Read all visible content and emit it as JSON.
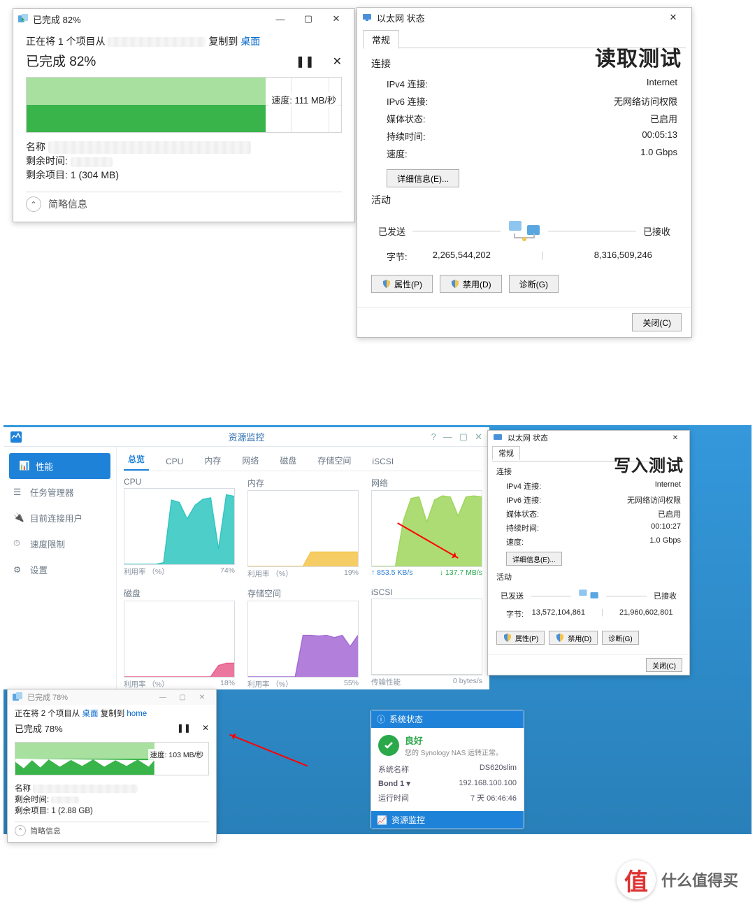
{
  "copy1": {
    "title": "已完成 82%",
    "sub_pre": "正在将 1 个项目从",
    "sub_mid": "复制到",
    "sub_dest": "桌面",
    "done_line": "已完成 82%",
    "pause_icon": "pause-icon",
    "cancel_icon": "close-icon",
    "speed_label": "速度:",
    "speed_value": "111 MB/秒",
    "name_label": "名称",
    "remaining_time_label": "剩余时间:",
    "remaining_items_label": "剩余项目:",
    "remaining_items_value": "1 (304 MB)",
    "brief_label": "简略信息",
    "pct_fill": 75
  },
  "eth1": {
    "title": "以太网 状态",
    "tab": "常规",
    "overlay_title": "读取测试",
    "conn_title": "连接",
    "ipv4_k": "IPv4 连接:",
    "ipv4_v": "Internet",
    "ipv6_k": "IPv6 连接:",
    "ipv6_v": "无网络访问权限",
    "media_k": "媒体状态:",
    "media_v": "已启用",
    "duration_k": "持续时间:",
    "duration_v": "00:05:13",
    "speed_k": "速度:",
    "speed_v": "1.0 Gbps",
    "details_btn": "详细信息(E)...",
    "activity_title": "活动",
    "sent_label": "已发送",
    "recv_label": "已接收",
    "bytes_k": "字节:",
    "sent_bytes": "2,265,544,202",
    "recv_bytes": "8,316,509,246",
    "props_btn": "属性(P)",
    "disable_btn": "禁用(D)",
    "diag_btn": "诊断(G)",
    "close_btn": "关闭(C)"
  },
  "rm": {
    "title": "资源监控",
    "sidebar": {
      "items": [
        {
          "label": "性能",
          "icon": "chart-icon"
        },
        {
          "label": "任务管理器",
          "icon": "list-icon"
        },
        {
          "label": "目前连接用户",
          "icon": "plug-icon"
        },
        {
          "label": "速度限制",
          "icon": "gauge-icon"
        },
        {
          "label": "设置",
          "icon": "gear-icon"
        }
      ]
    },
    "tabs": [
      "总览",
      "CPU",
      "内存",
      "网络",
      "磁盘",
      "存储空间",
      "iSCSI"
    ],
    "panes": {
      "cpu": {
        "title": "CPU",
        "footer_l": "利用率 （%）",
        "footer_r": "74%"
      },
      "mem": {
        "title": "内存",
        "footer_l": "利用率 （%）",
        "footer_r": "19%"
      },
      "net": {
        "title": "网络",
        "up": "↑ 853.5 KB/s",
        "down": "↓ 137.7 MB/s"
      },
      "disk": {
        "title": "磁盘",
        "footer_l": "利用率 （%）",
        "footer_r": "18%"
      },
      "vol": {
        "title": "存储空间",
        "footer_l": "利用率 （%）",
        "footer_r": "55%"
      },
      "iscsi": {
        "title": "iSCSI",
        "footer_l": "传输性能",
        "footer_r": "0 bytes/s"
      }
    }
  },
  "eth2": {
    "title": "以太网 状态",
    "tab": "常规",
    "overlay_title": "写入测试",
    "conn_title": "连接",
    "ipv4_k": "IPv4 连接:",
    "ipv4_v": "Internet",
    "ipv6_k": "IPv6 连接:",
    "ipv6_v": "无网络访问权限",
    "media_k": "媒体状态:",
    "media_v": "已启用",
    "duration_k": "持续时间:",
    "duration_v": "00:10:27",
    "speed_k": "速度:",
    "speed_v": "1.0 Gbps",
    "details_btn": "详细信息(E)...",
    "activity_title": "活动",
    "sent_label": "已发送",
    "recv_label": "已接收",
    "bytes_k": "字节:",
    "sent_bytes": "13,572,104,861",
    "recv_bytes": "21,960,602,801",
    "props_btn": "属性(P)",
    "disable_btn": "禁用(D)",
    "diag_btn": "诊断(G)",
    "close_btn": "关闭(C)"
  },
  "copy2": {
    "title": "已完成 78%",
    "sub_pre": "正在将 2 个项目从",
    "sub_src": "桌面",
    "sub_mid": "复制到",
    "sub_dest": "home",
    "done_line": "已完成 78%",
    "speed_label": "速度:",
    "speed_value": "103 MB/秒",
    "name_label": "名称",
    "remaining_time_label": "剩余时间:",
    "remaining_items_label": "剩余项目:",
    "remaining_items_value": "1 (2.88 GB)",
    "brief_label": "简略信息",
    "pct_fill": 72
  },
  "sys": {
    "header": "系统状态",
    "good": "良好",
    "good_sub": "您的 Synology NAS 运转正常。",
    "name_k": "系统名称",
    "name_v": "DS620slim",
    "bond_k": "Bond 1 ▾",
    "bond_v": "192.168.100.100",
    "uptime_k": "运行时间",
    "uptime_v": "7 天 06:46:46",
    "rm_label": "资源监控"
  },
  "badge": {
    "glyph": "值",
    "text": "什么值得买"
  },
  "chart_data": [
    {
      "type": "area",
      "title": "CPU",
      "ylabel": "利用率 %",
      "ylim": [
        0,
        100
      ],
      "series": [
        {
          "name": "cpu",
          "values": [
            0,
            0,
            0,
            0,
            0,
            2,
            85,
            82,
            60,
            78,
            86,
            88,
            20,
            92,
            90
          ]
        }
      ],
      "color": "#2fc6c0"
    },
    {
      "type": "area",
      "title": "内存",
      "ylabel": "利用率 %",
      "ylim": [
        0,
        100
      ],
      "series": [
        {
          "name": "mem",
          "values": [
            0,
            0,
            0,
            0,
            0,
            0,
            0,
            0,
            19,
            19,
            19,
            19,
            19,
            19,
            19
          ]
        }
      ],
      "color": "#f4c44a"
    },
    {
      "type": "area",
      "title": "网络",
      "ylabel": "MB/s",
      "ylim": [
        0,
        150
      ],
      "series": [
        {
          "name": "下载",
          "values": [
            0,
            0,
            0,
            0,
            90,
            135,
            138,
            88,
            132,
            140,
            138,
            100,
            138,
            140,
            138
          ]
        }
      ],
      "color": "#9ed65b",
      "annotations": {
        "upload": "853.5 KB/s",
        "download": "137.7 MB/s"
      }
    },
    {
      "type": "area",
      "title": "磁盘",
      "ylabel": "利用率 %",
      "ylim": [
        0,
        100
      ],
      "series": [
        {
          "name": "disk",
          "values": [
            0,
            0,
            0,
            0,
            0,
            0,
            0,
            0,
            0,
            0,
            0,
            0,
            15,
            18,
            18
          ]
        }
      ],
      "color": "#e85f8e"
    },
    {
      "type": "area",
      "title": "存储空间",
      "ylabel": "利用率 %",
      "ylim": [
        0,
        100
      ],
      "series": [
        {
          "name": "vol",
          "values": [
            0,
            0,
            0,
            0,
            0,
            0,
            0,
            55,
            55,
            54,
            55,
            52,
            55,
            40,
            55
          ]
        }
      ],
      "color": "#a46ad4"
    },
    {
      "type": "area",
      "title": "iSCSI",
      "ylabel": "bytes/s",
      "ylim": [
        0,
        1
      ],
      "series": [
        {
          "name": "iscsi",
          "values": [
            0,
            0,
            0,
            0,
            0,
            0,
            0,
            0,
            0,
            0,
            0,
            0,
            0,
            0,
            0
          ]
        }
      ],
      "color": "#ccc"
    }
  ]
}
